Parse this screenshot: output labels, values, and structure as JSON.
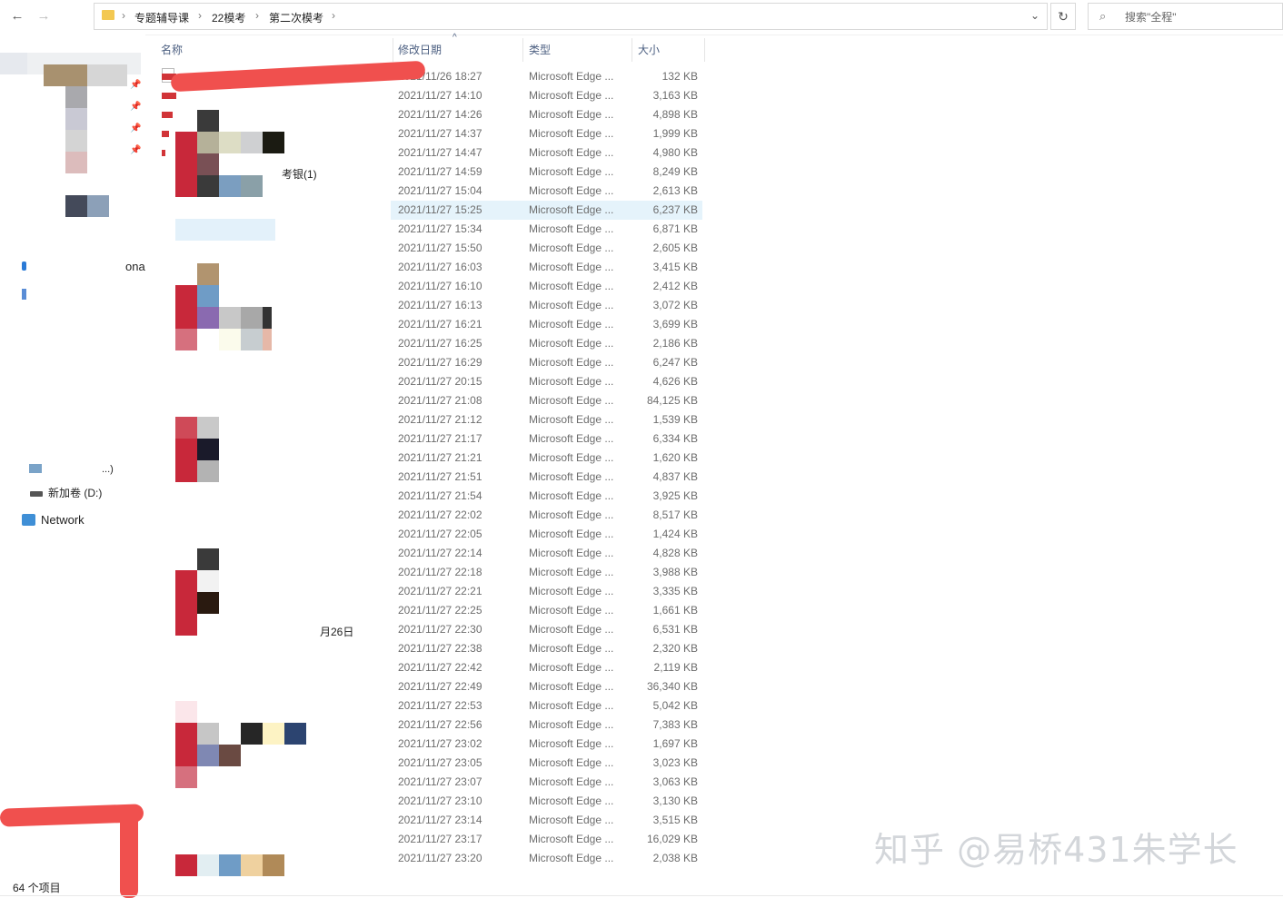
{
  "toolbar": {
    "back_icon": "←",
    "forward_icon": "→",
    "breadcrumbs": [
      "专题辅导课",
      "22模考",
      "第二次模考"
    ],
    "breadcrumb_sep": "›",
    "dropdown_icon": "⌄",
    "refresh_icon": "↻",
    "search_icon": "⌕",
    "search_placeholder": "搜索\"全程\""
  },
  "columns": {
    "name": "名称",
    "date": "修改日期",
    "type": "类型",
    "size": "大小",
    "sort_indicator": "^"
  },
  "nav": {
    "drive_label": "新加卷 (D:)",
    "network_label": "Network",
    "partial_text_1": "ona",
    "partial_text_2": "...)"
  },
  "file_name_fragments": {
    "frag1": "考银(1)",
    "frag2": "月26日"
  },
  "files": [
    {
      "date": "2021/11/26 18:27",
      "type": "Microsoft Edge ...",
      "size": "132 KB"
    },
    {
      "date": "2021/11/27 14:10",
      "type": "Microsoft Edge ...",
      "size": "3,163 KB"
    },
    {
      "date": "2021/11/27 14:26",
      "type": "Microsoft Edge ...",
      "size": "4,898 KB"
    },
    {
      "date": "2021/11/27 14:37",
      "type": "Microsoft Edge ...",
      "size": "1,999 KB"
    },
    {
      "date": "2021/11/27 14:47",
      "type": "Microsoft Edge ...",
      "size": "4,980 KB"
    },
    {
      "date": "2021/11/27 14:59",
      "type": "Microsoft Edge ...",
      "size": "8,249 KB"
    },
    {
      "date": "2021/11/27 15:04",
      "type": "Microsoft Edge ...",
      "size": "2,613 KB"
    },
    {
      "date": "2021/11/27 15:25",
      "type": "Microsoft Edge ...",
      "size": "6,237 KB"
    },
    {
      "date": "2021/11/27 15:34",
      "type": "Microsoft Edge ...",
      "size": "6,871 KB"
    },
    {
      "date": "2021/11/27 15:50",
      "type": "Microsoft Edge ...",
      "size": "2,605 KB"
    },
    {
      "date": "2021/11/27 16:03",
      "type": "Microsoft Edge ...",
      "size": "3,415 KB"
    },
    {
      "date": "2021/11/27 16:10",
      "type": "Microsoft Edge ...",
      "size": "2,412 KB"
    },
    {
      "date": "2021/11/27 16:13",
      "type": "Microsoft Edge ...",
      "size": "3,072 KB"
    },
    {
      "date": "2021/11/27 16:21",
      "type": "Microsoft Edge ...",
      "size": "3,699 KB"
    },
    {
      "date": "2021/11/27 16:25",
      "type": "Microsoft Edge ...",
      "size": "2,186 KB"
    },
    {
      "date": "2021/11/27 16:29",
      "type": "Microsoft Edge ...",
      "size": "6,247 KB"
    },
    {
      "date": "2021/11/27 20:15",
      "type": "Microsoft Edge ...",
      "size": "4,626 KB"
    },
    {
      "date": "2021/11/27 21:08",
      "type": "Microsoft Edge ...",
      "size": "84,125 KB"
    },
    {
      "date": "2021/11/27 21:12",
      "type": "Microsoft Edge ...",
      "size": "1,539 KB"
    },
    {
      "date": "2021/11/27 21:17",
      "type": "Microsoft Edge ...",
      "size": "6,334 KB"
    },
    {
      "date": "2021/11/27 21:21",
      "type": "Microsoft Edge ...",
      "size": "1,620 KB"
    },
    {
      "date": "2021/11/27 21:51",
      "type": "Microsoft Edge ...",
      "size": "4,837 KB"
    },
    {
      "date": "2021/11/27 21:54",
      "type": "Microsoft Edge ...",
      "size": "3,925 KB"
    },
    {
      "date": "2021/11/27 22:02",
      "type": "Microsoft Edge ...",
      "size": "8,517 KB"
    },
    {
      "date": "2021/11/27 22:05",
      "type": "Microsoft Edge ...",
      "size": "1,424 KB"
    },
    {
      "date": "2021/11/27 22:14",
      "type": "Microsoft Edge ...",
      "size": "4,828 KB"
    },
    {
      "date": "2021/11/27 22:18",
      "type": "Microsoft Edge ...",
      "size": "3,988 KB"
    },
    {
      "date": "2021/11/27 22:21",
      "type": "Microsoft Edge ...",
      "size": "3,335 KB"
    },
    {
      "date": "2021/11/27 22:25",
      "type": "Microsoft Edge ...",
      "size": "1,661 KB"
    },
    {
      "date": "2021/11/27 22:30",
      "type": "Microsoft Edge ...",
      "size": "6,531 KB"
    },
    {
      "date": "2021/11/27 22:38",
      "type": "Microsoft Edge ...",
      "size": "2,320 KB"
    },
    {
      "date": "2021/11/27 22:42",
      "type": "Microsoft Edge ...",
      "size": "2,119 KB"
    },
    {
      "date": "2021/11/27 22:49",
      "type": "Microsoft Edge ...",
      "size": "36,340 KB"
    },
    {
      "date": "2021/11/27 22:53",
      "type": "Microsoft Edge ...",
      "size": "5,042 KB"
    },
    {
      "date": "2021/11/27 22:56",
      "type": "Microsoft Edge ...",
      "size": "7,383 KB"
    },
    {
      "date": "2021/11/27 23:02",
      "type": "Microsoft Edge ...",
      "size": "1,697 KB"
    },
    {
      "date": "2021/11/27 23:05",
      "type": "Microsoft Edge ...",
      "size": "3,023 KB"
    },
    {
      "date": "2021/11/27 23:07",
      "type": "Microsoft Edge ...",
      "size": "3,063 KB"
    },
    {
      "date": "2021/11/27 23:10",
      "type": "Microsoft Edge ...",
      "size": "3,130 KB"
    },
    {
      "date": "2021/11/27 23:14",
      "type": "Microsoft Edge ...",
      "size": "3,515 KB"
    },
    {
      "date": "2021/11/27 23:17",
      "type": "Microsoft Edge ...",
      "size": "16,029 KB"
    },
    {
      "date": "2021/11/27 23:20",
      "type": "Microsoft Edge ...",
      "size": "2,038 KB"
    }
  ],
  "selected_row_index": 7,
  "status": {
    "item_count": "64 个项目"
  },
  "watermark": "知乎 @易桥431朱学长",
  "colors": {
    "selection": "#e5f3fb",
    "header_text": "#4d6082",
    "pdf_red": "#d13438",
    "marker_red": "#f0504e"
  }
}
